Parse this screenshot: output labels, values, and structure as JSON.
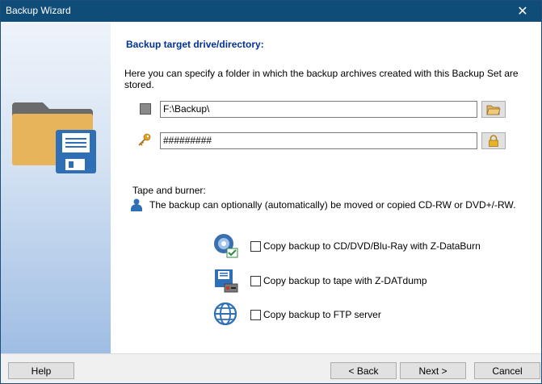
{
  "window": {
    "title": "Backup Wizard",
    "close_glyph": "✕"
  },
  "heading": "Backup target drive/directory:",
  "description": "Here you can specify a folder in which the backup archives created with this Backup Set are stored.",
  "target": {
    "path_value": "F:\\Backup\\",
    "password_value": "#########"
  },
  "tape": {
    "label": "Tape and burner:",
    "info": "The backup can optionally (automatically) be moved or copied CD-RW or DVD+/-RW."
  },
  "options": [
    {
      "label": "Copy backup to CD/DVD/Blu-Ray with Z-DataBurn",
      "checked": false,
      "icon": "disc-burn-icon"
    },
    {
      "label": "Copy backup to tape with Z-DATdump",
      "checked": false,
      "icon": "tape-drive-icon"
    },
    {
      "label": "Copy backup to FTP server",
      "checked": false,
      "icon": "globe-icon"
    }
  ],
  "footer": {
    "help": "Help",
    "back": "< Back",
    "next": "Next >",
    "cancel": "Cancel"
  },
  "colors": {
    "titlebar": "#0f4c78",
    "heading": "#003399",
    "folder": "#e7b45c",
    "floppy": "#2f6fb6"
  }
}
